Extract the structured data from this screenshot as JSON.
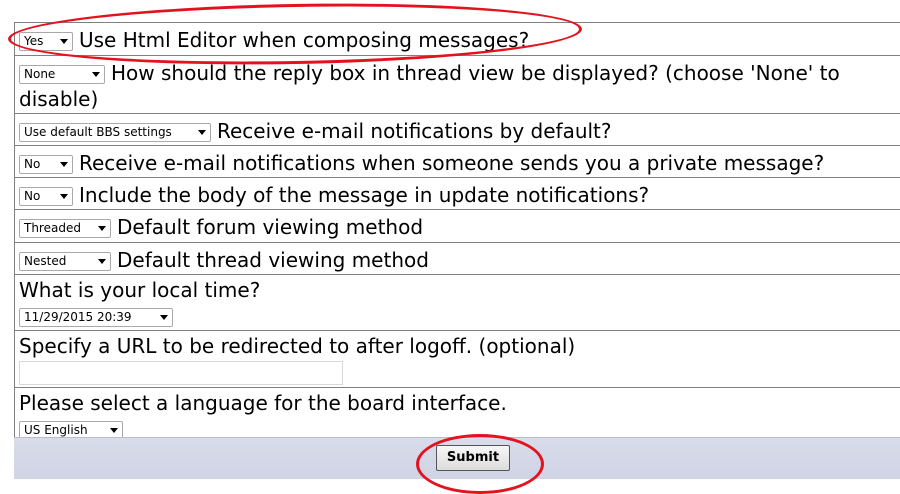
{
  "rows": [
    {
      "select": "Yes",
      "label": "Use Html Editor when composing messages?"
    },
    {
      "select": "None",
      "label": "How should the reply box in thread view be displayed? (choose 'None' to disable)"
    },
    {
      "select": "Use default BBS settings",
      "label": "Receive e-mail notifications by default?"
    },
    {
      "select": "No",
      "label": "Receive e-mail notifications when someone sends you a private message?"
    },
    {
      "select": "No",
      "label": "Include the body of the message in update notifications?"
    },
    {
      "select": "Threaded",
      "label": "Default forum viewing method"
    },
    {
      "select": "Nested",
      "label": "Default thread viewing method"
    }
  ],
  "local_time": {
    "label": "What is your local time?",
    "select": "11/29/2015 20:39"
  },
  "redirect": {
    "label": "Specify a URL to be redirected to after logoff. (optional)",
    "value": ""
  },
  "language": {
    "label": "Please select a language for the board interface.",
    "select": "US English"
  },
  "submit_label": "Submit",
  "annotation_color": "#e3121e"
}
